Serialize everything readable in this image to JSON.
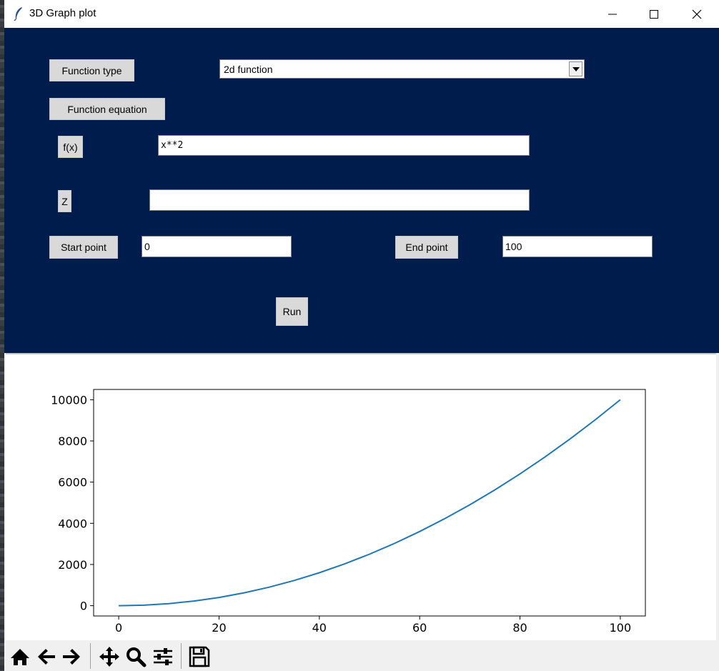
{
  "window": {
    "title": "3D Graph plot"
  },
  "form": {
    "function_type_label": "Function type",
    "function_type_value": "2d function",
    "function_equation_label": "Function equation",
    "fx_label": "f(x)",
    "fx_value": "x**2",
    "z_label": "Z",
    "z_value": "",
    "start_label": "Start point",
    "start_value": "0",
    "end_label": "End point",
    "end_value": "100",
    "run_label": "Run"
  },
  "colors": {
    "form_bg": "#001c4d",
    "line": "#1f77b4"
  },
  "chart_data": {
    "type": "line",
    "title": "",
    "xlabel": "",
    "ylabel": "",
    "xlim": [
      -5,
      105
    ],
    "ylim": [
      -500,
      10500
    ],
    "xticks": [
      "0",
      "20",
      "40",
      "60",
      "80",
      "100"
    ],
    "yticks": [
      "0",
      "2000",
      "4000",
      "6000",
      "8000",
      "10000"
    ],
    "grid": false,
    "series": [
      {
        "x": [
          0,
          5,
          10,
          15,
          20,
          25,
          30,
          35,
          40,
          45,
          50,
          55,
          60,
          65,
          70,
          75,
          80,
          85,
          90,
          95,
          100
        ],
        "y": [
          0,
          25,
          100,
          225,
          400,
          625,
          900,
          1225,
          1600,
          2025,
          2500,
          3025,
          3600,
          4225,
          4900,
          5625,
          6400,
          7225,
          8100,
          9025,
          10000
        ]
      }
    ]
  },
  "toolbar": {
    "items": [
      "home-icon",
      "back-icon",
      "forward-icon",
      "pan-icon",
      "zoom-icon",
      "configure-subplots-icon",
      "save-icon"
    ]
  }
}
